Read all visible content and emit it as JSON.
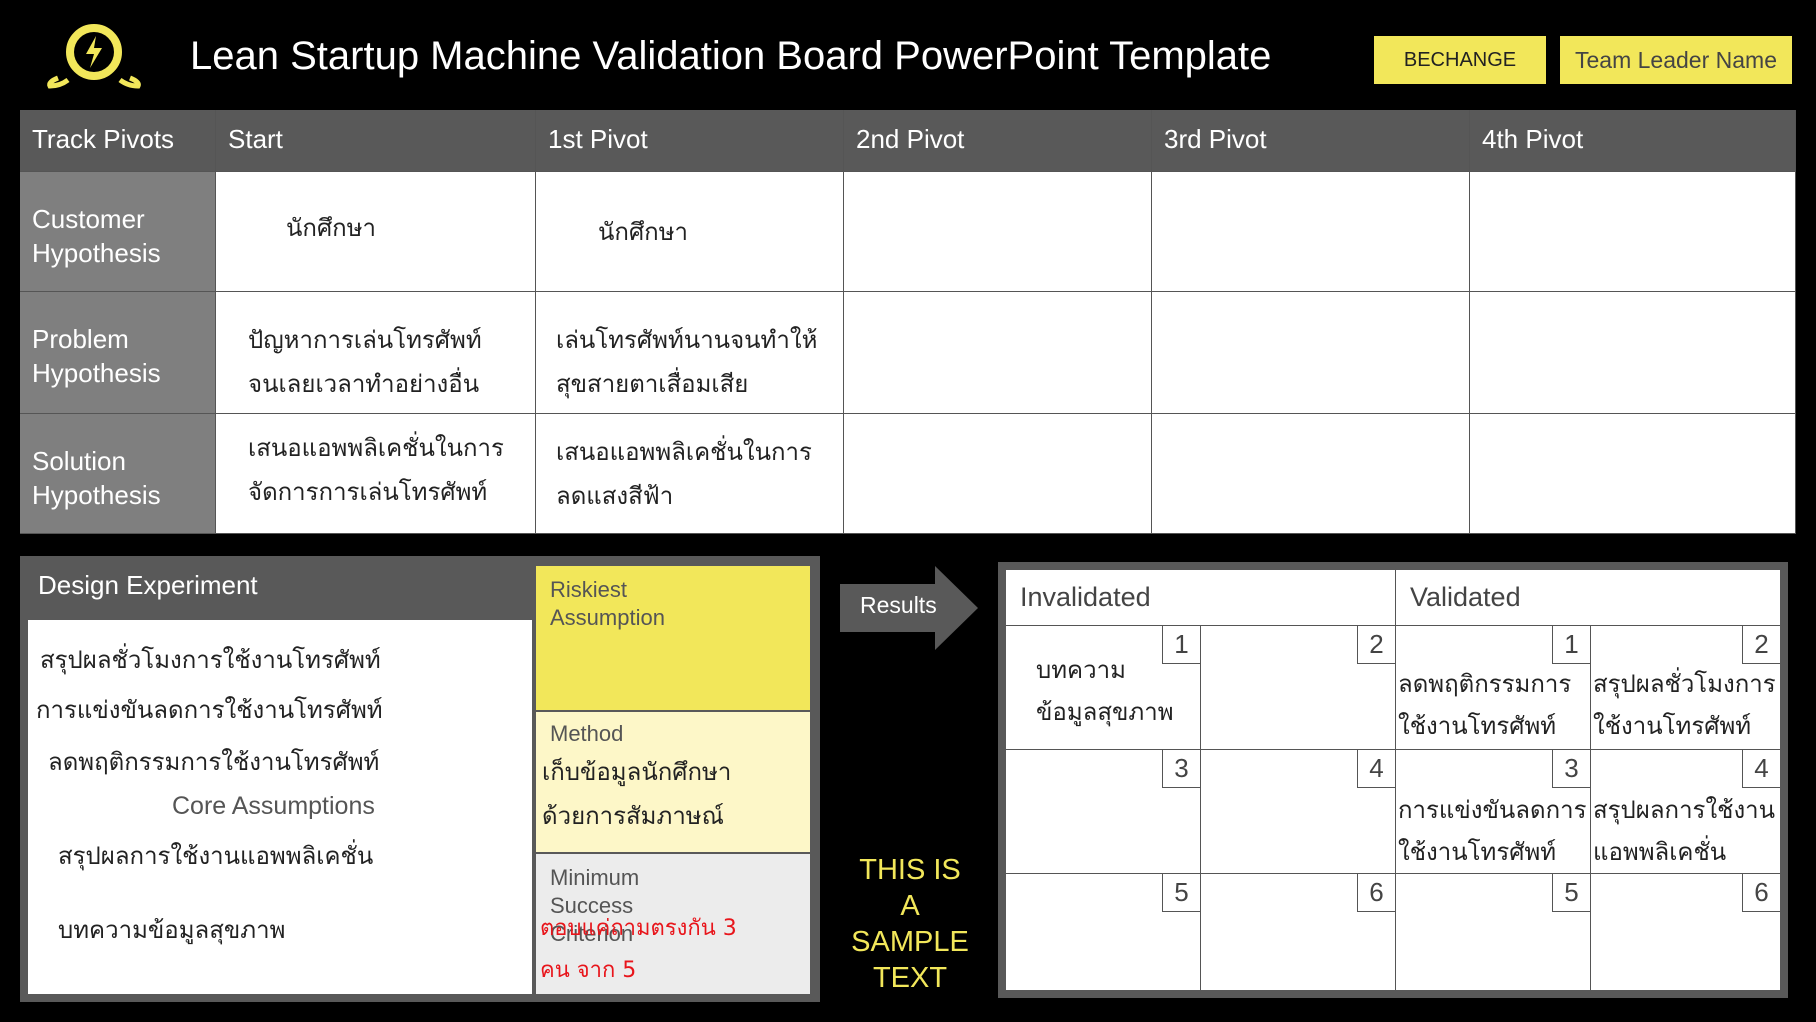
{
  "header": {
    "title": "Lean Startup Machine Validation Board PowerPoint Template",
    "tag_left": "BECHANGE",
    "tag_right": "Team Leader Name",
    "logo_icon": "lightning-bubble-icon"
  },
  "pivots": {
    "columns": [
      "Track Pivots",
      "Start",
      "1st Pivot",
      "2nd Pivot",
      "3rd Pivot",
      "4th Pivot"
    ],
    "rows": [
      {
        "label": "Customer Hypothesis",
        "start": "นักศึกษา",
        "pivot1": "นักศึกษา"
      },
      {
        "label": "Problem Hypothesis",
        "start_l1": "ปัญหาการเล่นโทรศัพท์",
        "start_l2": "จนเลยเวลาทำอย่างอื่น",
        "pivot1_l1": "เล่นโทรศัพท์นานจนทำให้",
        "pivot1_l2": "สุขสายตาเสื่อมเสีย"
      },
      {
        "label": "Solution Hypothesis",
        "start_l1": "เสนอแอพพลิเคชั่นในการ",
        "start_l2": "จัดการการเล่นโทรศัพท์",
        "pivot1_l1": "เสนอแอพพลิเคชั่นในการ",
        "pivot1_l2": "ลดแสงสีฟ้า"
      }
    ]
  },
  "design": {
    "title": "Design Experiment",
    "lines": [
      "สรุปผลชั่วโมงการใช้งานโทรศัพท์",
      "การแข่งขันลดการใช้งานโทรศัพท์",
      "ลดพฤติกรรมการใช้งานโทรศัพท์",
      "สรุปผลการใช้งานแอพพลิเคชั่น",
      "บทความข้อมูลสุขภาพ"
    ],
    "core_assumptions": "Core Assumptions",
    "riskiest": "Riskiest Assumption",
    "method_label": "Method",
    "method_l1": "เก็บข้อมูลนักศึกษา",
    "method_l2": "ด้วยการสัมภาษณ์",
    "msc_label": "Minimum Success Criterion",
    "msc_red_l1": "ตอบแค่ถามตรงกัน 3",
    "msc_red_l2": "คน จาก 5"
  },
  "results": {
    "arrow_label": "Results",
    "sample": [
      "THIS IS",
      "A",
      "SAMPLE",
      "TEXT"
    ],
    "invalidated": "Invalidated",
    "validated": "Validated",
    "numbers": [
      "1",
      "2",
      "3",
      "4",
      "5",
      "6"
    ],
    "inv1_l1": "บทความ",
    "inv1_l2": "ข้อมูลสุขภาพ",
    "val1_l1": "ลดพฤติกรรมการ",
    "val1_l2": "ใช้งานโทรศัพท์",
    "val2_l1": "สรุปผลชั่วโมงการ",
    "val2_l2": "ใช้งานโทรศัพท์",
    "val3_l1": "การแข่งขันลดการ",
    "val3_l2": "ใช้งานโทรศัพท์",
    "val4_l1": "สรุปผลการใช้งาน",
    "val4_l2": "แอพพลิเคชั่น"
  },
  "colors": {
    "accent": "#f2e75a",
    "header_gray": "#595959",
    "row_gray": "#7f7f7f",
    "red": "#e8151b"
  }
}
